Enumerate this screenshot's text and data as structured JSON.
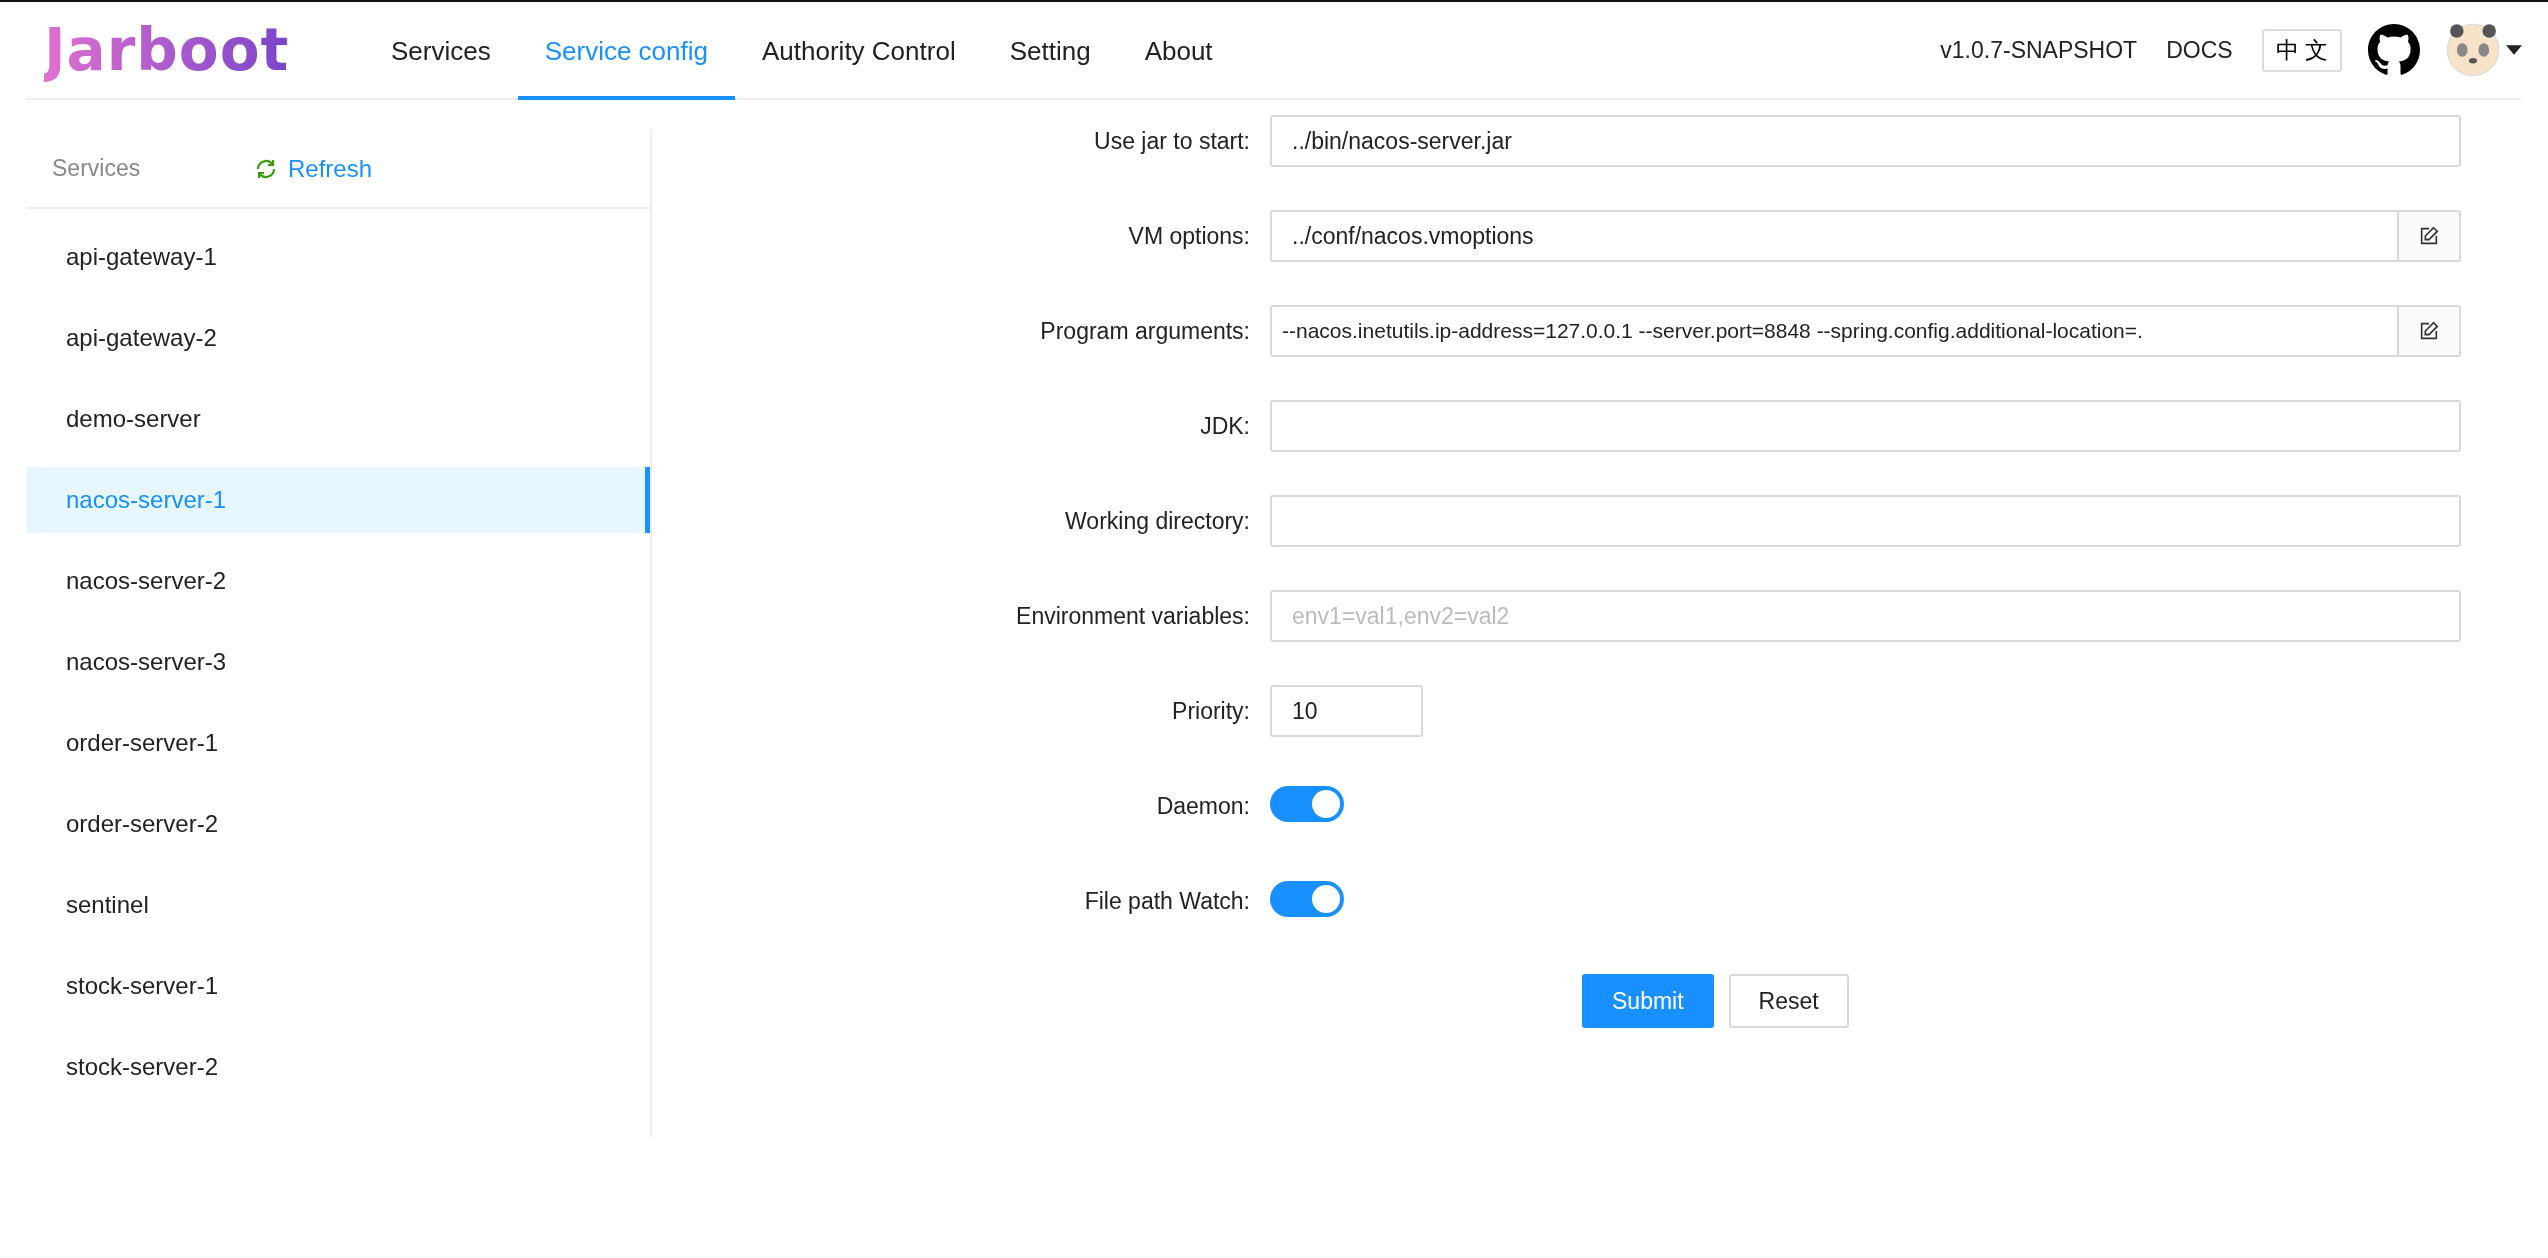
{
  "header": {
    "logo": "Jarboot",
    "nav": [
      {
        "label": "Services",
        "selected": false
      },
      {
        "label": "Service config",
        "selected": true
      },
      {
        "label": "Authority Control",
        "selected": false
      },
      {
        "label": "Setting",
        "selected": false
      },
      {
        "label": "About",
        "selected": false
      }
    ],
    "version": "v1.0.7-SNAPSHOT",
    "docs": "DOCS",
    "language": "中 文"
  },
  "sidebar": {
    "title": "Services",
    "refresh": "Refresh",
    "items": [
      {
        "label": "api-gateway-1",
        "selected": false
      },
      {
        "label": "api-gateway-2",
        "selected": false
      },
      {
        "label": "demo-server",
        "selected": false
      },
      {
        "label": "nacos-server-1",
        "selected": true
      },
      {
        "label": "nacos-server-2",
        "selected": false
      },
      {
        "label": "nacos-server-3",
        "selected": false
      },
      {
        "label": "order-server-1",
        "selected": false
      },
      {
        "label": "order-server-2",
        "selected": false
      },
      {
        "label": "sentinel",
        "selected": false
      },
      {
        "label": "stock-server-1",
        "selected": false
      },
      {
        "label": "stock-server-2",
        "selected": false
      }
    ]
  },
  "form": {
    "fields": [
      {
        "kind": "text",
        "label": "Use jar to start:",
        "value": "../bin/nacos-server.jar"
      },
      {
        "kind": "editable",
        "label": "VM options:",
        "value": "../conf/nacos.vmoptions"
      },
      {
        "kind": "editable",
        "label": "Program arguments:",
        "value": "--nacos.inetutils.ip-address=127.0.0.1 --server.port=8848 --spring.config.additional-location=."
      },
      {
        "kind": "text",
        "label": "JDK:"
      },
      {
        "kind": "text",
        "label": "Working directory:"
      },
      {
        "kind": "text",
        "label": "Environment variables:",
        "placeholder": "env1=val1,env2=val2"
      },
      {
        "kind": "number",
        "label": "Priority:",
        "value": "10"
      },
      {
        "kind": "switch",
        "label": "Daemon:",
        "on": true
      },
      {
        "kind": "switch",
        "label": "File path Watch:",
        "on": true
      }
    ],
    "buttons": [
      {
        "label": "Submit",
        "kind": "primary"
      },
      {
        "label": "Reset",
        "kind": "default"
      }
    ]
  }
}
